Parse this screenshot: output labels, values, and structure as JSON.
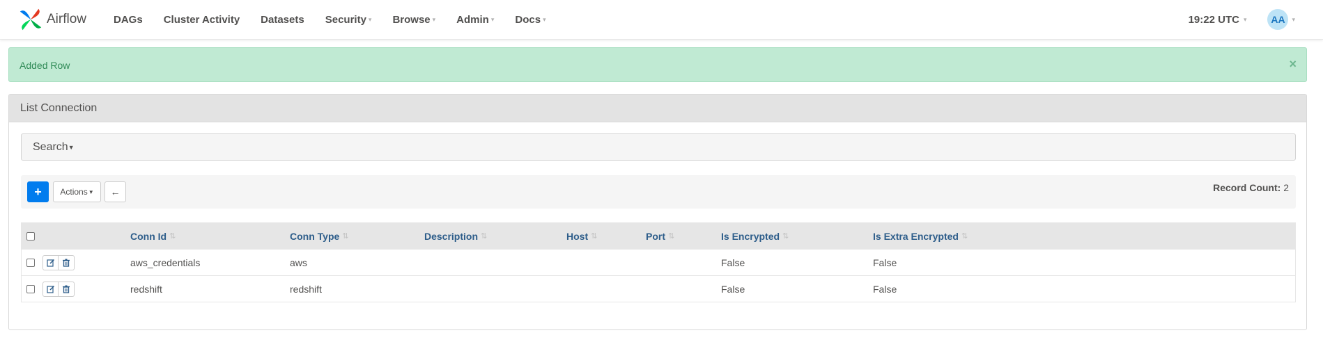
{
  "brand": {
    "name": "Airflow"
  },
  "nav": {
    "items": [
      {
        "label": "DAGs",
        "dropdown": false
      },
      {
        "label": "Cluster Activity",
        "dropdown": false
      },
      {
        "label": "Datasets",
        "dropdown": false
      },
      {
        "label": "Security",
        "dropdown": true
      },
      {
        "label": "Browse",
        "dropdown": true
      },
      {
        "label": "Admin",
        "dropdown": true
      },
      {
        "label": "Docs",
        "dropdown": true
      }
    ],
    "time": "19:22 UTC",
    "user_initials": "AA"
  },
  "alert": {
    "message": "Added Row",
    "close_glyph": "×",
    "color": "#c0ead3"
  },
  "panel": {
    "title": "List Connection",
    "search_label": "Search",
    "add_glyph": "+",
    "actions_label": "Actions",
    "back_glyph": "←",
    "record_count_label": "Record Count:",
    "record_count_value": "2"
  },
  "table": {
    "columns": [
      "Conn Id",
      "Conn Type",
      "Description",
      "Host",
      "Port",
      "Is Encrypted",
      "Is Extra Encrypted"
    ],
    "rows": [
      {
        "conn_id": "aws_credentials",
        "conn_type": "aws",
        "description": "",
        "host": "",
        "port": "",
        "is_encrypted": "False",
        "is_extra_encrypted": "False"
      },
      {
        "conn_id": "redshift",
        "conn_type": "redshift",
        "description": "",
        "host": "",
        "port": "",
        "is_encrypted": "False",
        "is_extra_encrypted": "False"
      }
    ]
  },
  "colors": {
    "accent": "#017cee",
    "header_link": "#2d5d8a",
    "panel_header": "#e3e3e3"
  },
  "icons": {
    "edit": "edit-icon",
    "delete": "trash-icon",
    "sort": "sort-icon"
  }
}
